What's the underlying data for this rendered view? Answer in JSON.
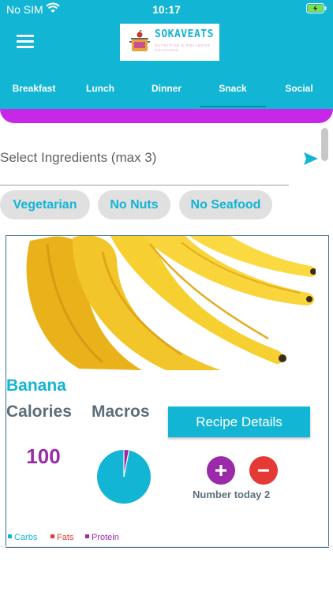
{
  "status_bar": {
    "carrier": "No SIM",
    "time": "10:17"
  },
  "app": {
    "brand": "SOKAVEATS",
    "tagline": "NUTRITION & WELLNESS COACHING"
  },
  "tabs": [
    {
      "label": "Breakfast"
    },
    {
      "label": "Lunch"
    },
    {
      "label": "Dinner"
    },
    {
      "label": "Snack",
      "selected": true
    },
    {
      "label": "Social"
    }
  ],
  "search": {
    "placeholder": "Select Ingredients (max 3)",
    "value": ""
  },
  "filters": [
    {
      "label": "Vegetarian"
    },
    {
      "label": "No Nuts"
    },
    {
      "label": "No Seafood"
    }
  ],
  "recipe": {
    "name": "Banana",
    "calories_label": "Calories",
    "macros_label": "Macros",
    "details_button": "Recipe Details",
    "calories": "100",
    "count_text": "Number today 2"
  },
  "macros_chart": {
    "legend": [
      {
        "name": "Carbs",
        "color": "#13b5d4"
      },
      {
        "name": "Fats",
        "color": "#e53935"
      },
      {
        "name": "Protein",
        "color": "#9b2aa8"
      }
    ]
  },
  "colors": {
    "primary": "#13b5d4",
    "accent": "#c727e6",
    "purple": "#9b2aa8",
    "red": "#e53935"
  }
}
